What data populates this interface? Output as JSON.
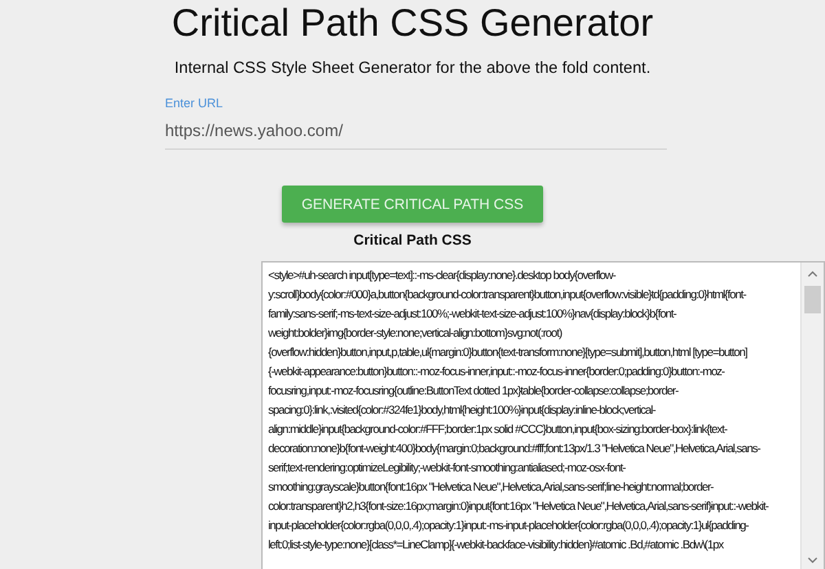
{
  "header": {
    "title": "Critical Path CSS Generator",
    "subtitle": "Internal CSS Style Sheet Generator for the above the fold content."
  },
  "url_field": {
    "label": "Enter URL",
    "value": "https://news.yahoo.com/"
  },
  "generate_button": {
    "label": "GENERATE CRITICAL PATH CSS"
  },
  "output": {
    "label": "Critical Path CSS",
    "lines": [
      "<style>#uh-search input[type=text]::-ms-clear{display:none}.desktop body{overflow-",
      "y:scroll}body{color:#000}a,button{background-color:transparent}button,input{overflow:visible}td{padding:0}html{font-",
      "family:sans-serif;-ms-text-size-adjust:100%;-webkit-text-size-adjust:100%}nav{display:block}b{font-",
      "weight:bolder}img{border-style:none;vertical-align:bottom}svg:not(:root)",
      "{overflow:hidden}button,input,p,table,ul{margin:0}button{text-transform:none}[type=submit],button,html [type=button]",
      "{-webkit-appearance:button}button::-moz-focus-inner,input::-moz-focus-inner{border:0;padding:0}button:-moz-",
      "focusring,input:-moz-focusring{outline:ButtonText dotted 1px}table{border-collapse:collapse;border-",
      "spacing:0}:link,:visited{color:#324fe1}body,html{height:100%}input{display:inline-block;vertical-",
      "align:middle}input{background-color:#FFF;border:1px solid #CCC}button,input{box-sizing:border-box}:link{text-",
      "decoration:none}b{font-weight:400}body{margin:0;background:#fff;font:13px/1.3 \"Helvetica Neue\",Helvetica,Arial,sans-",
      "serif;text-rendering:optimizeLegibility;-webkit-font-smoothing:antialiased;-moz-osx-font-",
      "smoothing:grayscale}button{font:16px \"Helvetica Neue\",Helvetica,Arial,sans-serif;line-height:normal;border-",
      "color:transparent}h2,h3{font-size:16px;margin:0}input{font:16px \"Helvetica Neue\",Helvetica,Arial,sans-serif}input::-webkit-",
      "input-placeholder{color:rgba(0,0,0,.4);opacity:1}input:-ms-input-placeholder{color:rgba(0,0,0,.4);opacity:1}ul{padding-",
      "left:0;list-style-type:none}[class*=LineClamp]{-webkit-backface-visibility:hidden}#atomic .Bd,#atomic .Bdw\\(1px"
    ]
  }
}
